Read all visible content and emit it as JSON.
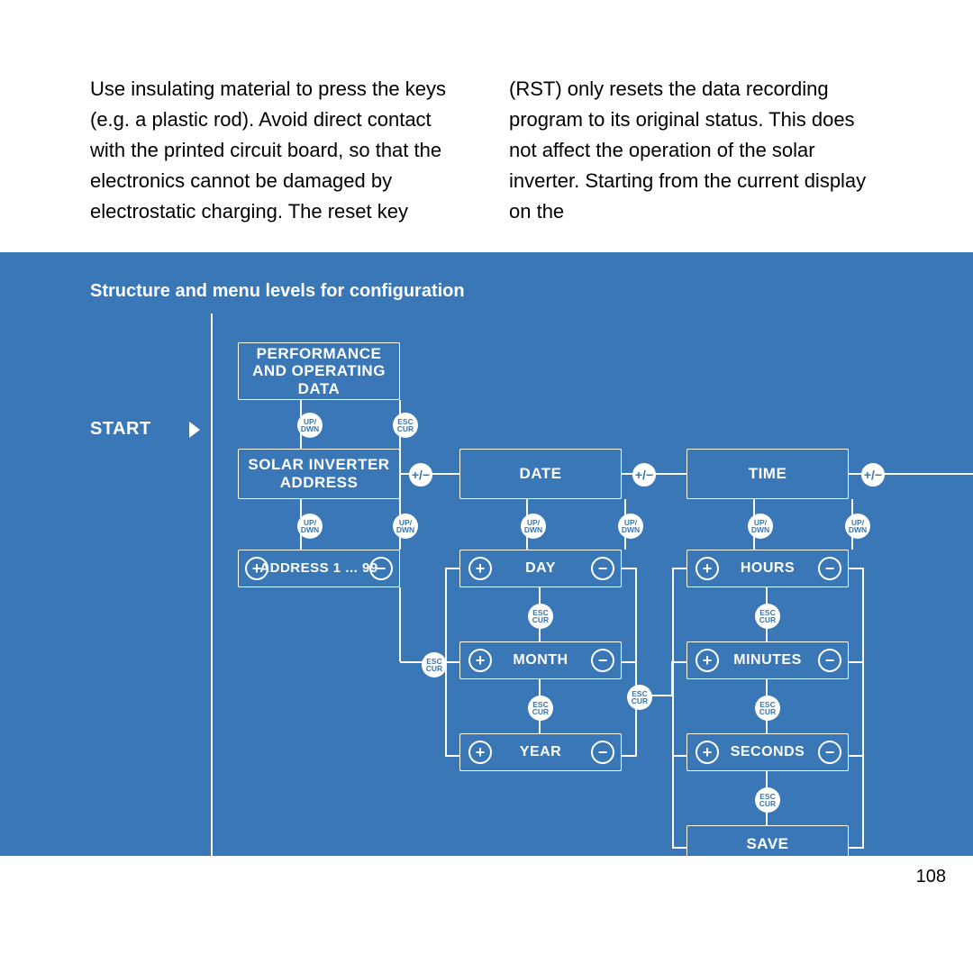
{
  "body_text": "Use insulating material to press the keys (e.g. a plastic rod). Avoid direct contact with the printed circuit board, so that the electronics cannot be damaged by electrostatic charging. The reset key (RST) only resets the data recording program to its original status. This does not affect the operation of the solar inverter.\n\nStarting from the current display on the",
  "band_title": "Structure and menu levels for configuration",
  "diagram": {
    "start": "START",
    "box_perf": "PERFORMANCE AND OPERATING DATA",
    "box_addr": "SOLAR INVERTER ADDRESS",
    "box_addr_range": "ADDRESS 1 ... 99",
    "box_date": "DATE",
    "box_time": "TIME",
    "box_day": "DAY",
    "box_month": "MONTH",
    "box_year": "YEAR",
    "box_hours": "HOURS",
    "box_minutes": "MINUTES",
    "box_seconds": "SECONDS",
    "box_save": "SAVE",
    "badge_updwn_top": "UP/",
    "badge_updwn_bot": "DWN",
    "badge_esccur_top": "ESC",
    "badge_esccur_bot": "CUR",
    "btn_plus": "+",
    "btn_minus": "−",
    "btn_pm": "+/−"
  },
  "page_number": "108"
}
